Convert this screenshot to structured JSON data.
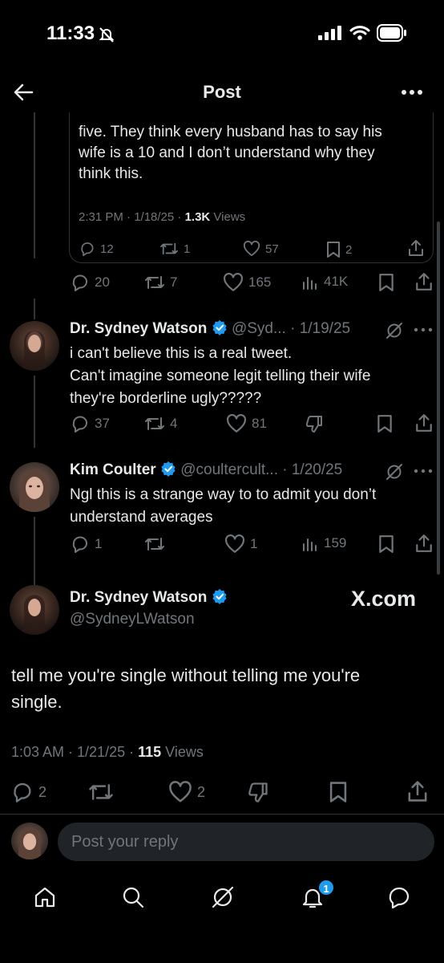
{
  "status_bar": {
    "time": "11:33"
  },
  "header": {
    "title": "Post"
  },
  "quoted_post": {
    "text_line1": "five. They think every husband has to say his",
    "text_line2": "wife is a 10 and I don’t understand why they",
    "text_line3": "think this.",
    "time": "2:31 PM · 1/18/25 · ",
    "views_count": "1.3K",
    "views_label": " Views",
    "replies": "12",
    "reposts": "1",
    "likes": "57",
    "bookmarks": "2"
  },
  "parent_post_actions": {
    "replies": "20",
    "reposts": "7",
    "likes": "165",
    "views": "41K"
  },
  "replies": [
    {
      "name": "Dr. Sydney Watson",
      "handle_date": "@Syd... · 1/19/25",
      "line1": "i can't believe this is a real tweet.",
      "line2": "Can't imagine someone legit telling their wife",
      "line3": "they're borderline ugly?????",
      "replies": "37",
      "reposts": "4",
      "likes": "81"
    },
    {
      "name": "Kim Coulter",
      "handle_date": "@coultercult... · 1/20/25",
      "line1": "Ngl this is a strange way to to admit you don’t",
      "line2": "understand averages",
      "replies": "1",
      "likes": "1",
      "views": "159"
    }
  ],
  "main_post": {
    "name": "Dr. Sydney Watson",
    "handle": "@SydneyLWatson",
    "watermark": "X.com",
    "line1": "tell me you're single without telling me you're",
    "line2": "single.",
    "time": "1:03 AM · 1/21/25 · ",
    "views_count": "115",
    "views_label": " Views",
    "replies": "2",
    "likes": "2"
  },
  "reply_composer": {
    "placeholder": "Post your reply"
  },
  "bottom_nav": {
    "notification_badge": "1"
  },
  "colors": {
    "accent": "#1d9bf0",
    "text": "#e7e9ea",
    "muted": "#71767b",
    "border": "#2f3336"
  }
}
